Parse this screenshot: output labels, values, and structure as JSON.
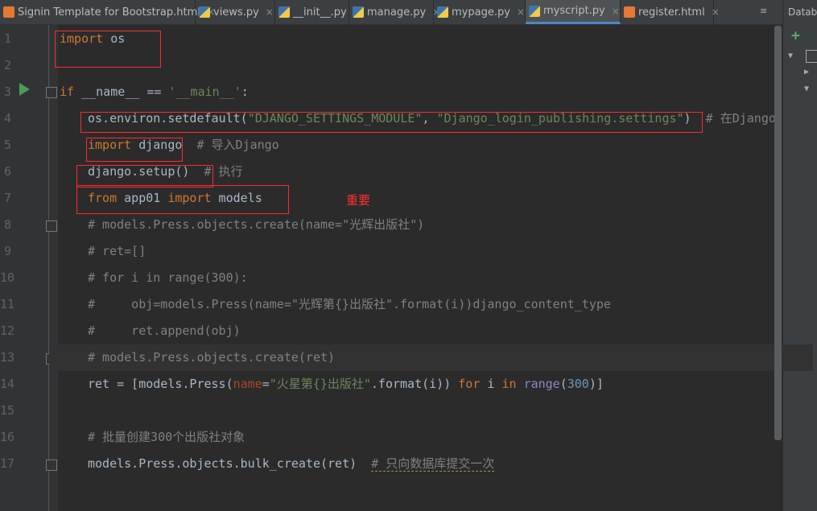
{
  "tabs": [
    {
      "label": "Signin Template for Bootstrap.html",
      "icon": "html-file-icon",
      "active": false
    },
    {
      "label": "views.py",
      "icon": "python-file-icon",
      "active": false
    },
    {
      "label": "__init__.py",
      "icon": "python-file-icon",
      "active": false
    },
    {
      "label": "manage.py",
      "icon": "python-file-icon",
      "active": false
    },
    {
      "label": "mypage.py",
      "icon": "python-file-icon",
      "active": false
    },
    {
      "label": "myscript.py",
      "icon": "python-file-icon",
      "active": true
    },
    {
      "label": "register.html",
      "icon": "html-file-icon",
      "active": false
    }
  ],
  "tab_close": "×",
  "tab_menu": "≡",
  "right_panel": {
    "title": "Databa",
    "add": "+"
  },
  "line_numbers": [
    "1",
    "2",
    "3",
    "4",
    "5",
    "6",
    "7",
    "8",
    "9",
    "10",
    "11",
    "12",
    "13",
    "14",
    "15",
    "16",
    "17"
  ],
  "code": {
    "l1": {
      "kw": "import",
      "rest": " os"
    },
    "l3": {
      "kw": "if",
      "mid": " __name__ == ",
      "str": "'__main__'",
      "end": ":"
    },
    "l4": {
      "a": "os.environ.setdefault(",
      "s1": "\"DJANGO_SETTINGS_MODULE\"",
      "b": ", ",
      "s2": "\"Django_login_publishing.settings\"",
      "c": ")  ",
      "cm": "# 在Django"
    },
    "l5": {
      "kw": "import",
      "rest": " django  ",
      "cm": "# 导入Django"
    },
    "l6": {
      "a": "django.setup()  ",
      "cm": "# 执行"
    },
    "l7": {
      "kw1": "from",
      "mid": " app01 ",
      "kw2": "import",
      "rest": " models"
    },
    "l8": "# models.Press.objects.create(name=\"光辉出版社\")",
    "l9": "# ret=[]",
    "l10": "# for i in range(300):",
    "l11": "#     obj=models.Press(name=\"光辉第{}出版社\".format(i))django_content_type",
    "l12": "#     ret.append(obj)",
    "l13": "# models.Press.objects.create(ret)",
    "l14": {
      "a": "ret = [models.Press(",
      "kwarg": "name",
      "eq": "=",
      "str": "\"火星第{}出版社\"",
      "b": ".format(i)) ",
      "kw1": "for",
      "c": " i ",
      "kw2": "in",
      "d": " ",
      "bi": "range",
      "e": "(",
      "num": "300",
      "f": ")]"
    },
    "l16": "# 批量创建300个出版社对象",
    "l17": {
      "a": "models.Press.objects.bulk_create(ret)  ",
      "cm": "# 只向数据库提交一次"
    }
  },
  "annotation": "重要"
}
